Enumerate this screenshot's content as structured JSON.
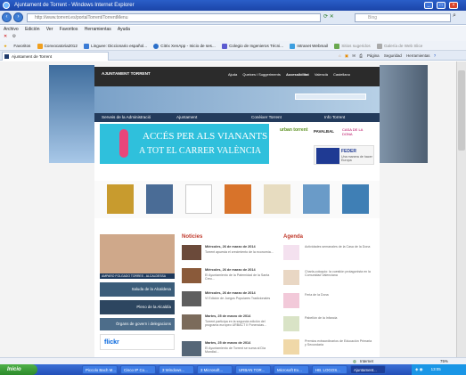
{
  "window": {
    "title": "Ajuntament de Torrent - Windows Internet Explorer"
  },
  "address": {
    "url": "http://www.torrent.es/portalTorrent/TorrentMenu",
    "search_placeholder": "Bing"
  },
  "menu": [
    "Archivo",
    "Edición",
    "Ver",
    "Favoritos",
    "Herramientas",
    "Ayuda"
  ],
  "favorites": {
    "label": "Favoritos",
    "items": [
      "Convocatoria2012",
      "Linguee: Diccionario español...",
      "Citrix XenApp - Inicio de ses...",
      "Colegio de Ingenieros Técni...",
      "Intranet Webmail",
      "Sitios sugeridos",
      "Galería de Web Slice"
    ]
  },
  "tab": {
    "label": "Ajuntament de Torrent"
  },
  "commands": [
    "Página",
    "Seguridad",
    "Herramientas"
  ],
  "site": {
    "logo": "AJUNTAMENT TORRENT",
    "top_nav": [
      "Ajuda",
      "Queixes i Suggeriments",
      "Accessibilitat",
      "Valencià",
      "Castellano"
    ],
    "main_nav": [
      "Serveis de la Administració",
      "Ajuntament",
      "Conèixer Torrent",
      "Info Torrent"
    ],
    "banner_line1": "ACCÉS PER ALS VIANANTS",
    "banner_line2": "A TOT EL CARRER VALÈNCIA",
    "partners": [
      "urban torrent",
      "PAVALBAL",
      "CASA DE LA DONA"
    ],
    "feder_label": "FEDER",
    "feder_slogan": "Una manera de hacer Europa",
    "left_boxes": [
      "AMPARO FOLGADO TORRES - ALCALDESSA",
      "Saluda de la Alcaldesa",
      "Pleno de la Alcaldía",
      "Òrgans de govern i delegacions",
      "flickr"
    ],
    "news_heading": "Noticies",
    "news": [
      {
        "date": "Miércoles, 26 de marzo de 2014",
        "text": "Torrent apuesta el crecimiento de la economía..."
      },
      {
        "date": "Miércoles, 26 de marzo de 2014",
        "text": "El Ayuntamiento de la Paternidad de la Santa Creu..."
      },
      {
        "date": "Miércoles, 26 de marzo de 2014",
        "text": "VI Edición de Juegos Populares Tradicionales"
      },
      {
        "date": "Martes, 25 de marzo de 2014",
        "text": "Torrent participa en la segunda edición del programa europeo URBACT II Ponencias..."
      },
      {
        "date": "Martes, 25 de marzo de 2014",
        "text": "El Ayuntamiento de Torrent se suma al Día Mundial..."
      }
    ],
    "agenda_heading": "Agenda",
    "agenda": [
      "Actividades semanales de la Casa de la Dona",
      "Charla-coloquio: la cuestión protagonista en la Comunidad Valenciana",
      "Feria de la Dona",
      "Pabellón de la Infancia",
      "Premios extraordinarios de Educación Primaria y Secundaria"
    ]
  },
  "status": {
    "zone": "Internet",
    "zoom": "75%"
  },
  "taskbar": {
    "start": "Inicio",
    "tasks": [
      "Piccolo Bach M...",
      "Cisco IP Co...",
      "3 Windows...",
      "3 Microsoft...",
      "URBAN TOR...",
      "Microsoft Ex...",
      "HB. LOGOS...",
      "Ajuntament..."
    ],
    "clock": "13:05"
  }
}
